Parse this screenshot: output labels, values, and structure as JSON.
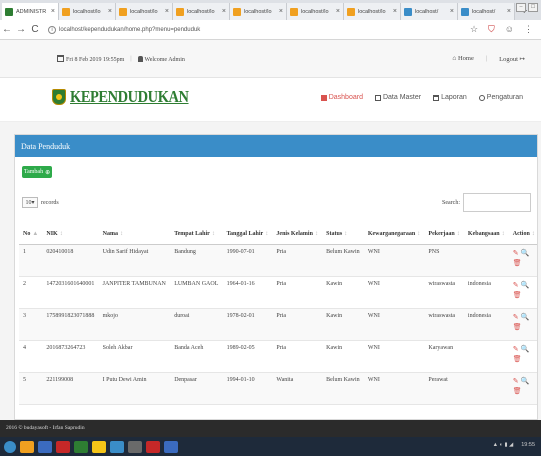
{
  "browser": {
    "tabs": [
      {
        "label": "ADMINISTR",
        "color": "#2e7d32",
        "active": true
      },
      {
        "label": "localhost/lo",
        "color": "#f0a020"
      },
      {
        "label": "localhost/lo",
        "color": "#f0a020"
      },
      {
        "label": "localhost/lo",
        "color": "#f0a020"
      },
      {
        "label": "localhost/lo",
        "color": "#f0a020"
      },
      {
        "label": "localhost/lo",
        "color": "#f0a020"
      },
      {
        "label": "localhost/lo",
        "color": "#f0a020"
      },
      {
        "label": "localhost/",
        "color": "#3a8dc8"
      },
      {
        "label": "localhost/",
        "color": "#3a8dc8"
      }
    ],
    "new_tab": "+",
    "url": "localhost/kependudukan/home.php?menu=penduduk"
  },
  "infobar": {
    "datetime": "Fri 8 Feb 2019 19:55pm",
    "welcome": "Welcome Admin",
    "home": "Home",
    "logout": "Logout"
  },
  "header": {
    "brand": "KEPENDUDUKAN",
    "menu": [
      {
        "label": "Dashboard",
        "icon": "grid-icon",
        "active": true
      },
      {
        "label": "Data Master",
        "icon": "database-icon"
      },
      {
        "label": "Laporan",
        "icon": "print-icon"
      },
      {
        "label": "Pengaturan",
        "icon": "gear-icon"
      }
    ]
  },
  "panel": {
    "title": "Data Penduduk",
    "add_label": "Tambah",
    "length_value": "10",
    "length_suffix": "records",
    "search_label": "Search:"
  },
  "table": {
    "headers": [
      "No",
      "NIK",
      "Nama",
      "Tempat Lahir",
      "Tanggal Lahir",
      "Jenis Kelamin",
      "Status",
      "Kewarganegaraan",
      "Pekerjaan",
      "Kebangsaan",
      "Action"
    ],
    "rows": [
      [
        "1",
        "020410018",
        "Udin Sarif Hidayat",
        "Bandung",
        "1990-07-01",
        "Pria",
        "Belum Kawin",
        "WNI",
        "PNS",
        ""
      ],
      [
        "2",
        "1472031601640001",
        "JANPITER TAMBUNAN",
        "LUMBAN GAOL",
        "1964-01-16",
        "Pria",
        "Kawin",
        "WNI",
        "wiraswasta",
        "indonesia"
      ],
      [
        "3",
        "1758991823071888",
        "mkojo",
        "duroai",
        "1978-02-01",
        "Pria",
        "Kawin",
        "WNI",
        "wiraswasta",
        "indonesia"
      ],
      [
        "4",
        "2016873264723",
        "Soleh Akbar",
        "Banda Aceh",
        "1989-02-05",
        "Pria",
        "Kawin",
        "WNI",
        "Karyawan",
        ""
      ],
      [
        "5",
        "221199008",
        "I Putu Dewi Amin",
        "Denpasar",
        "1994-01-10",
        "Wanita",
        "Belum Kawin",
        "WNI",
        "Perawat",
        ""
      ]
    ]
  },
  "footer": {
    "text": "2016 © budayasoft - Irfan Saprudin"
  },
  "taskbar": {
    "time": "19:55"
  }
}
